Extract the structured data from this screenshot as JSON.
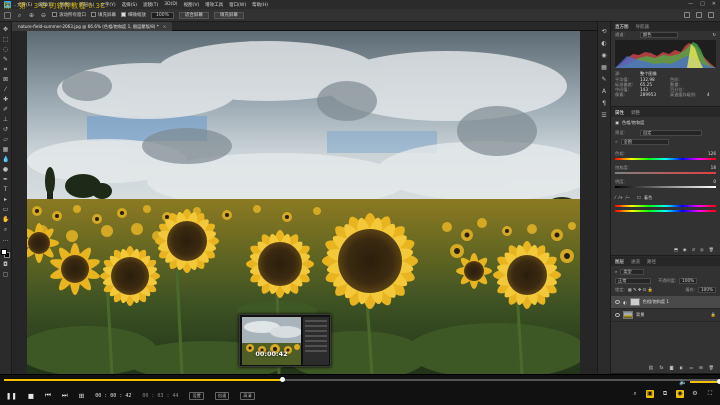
{
  "menubar": {
    "overlay_title": "陈 · 第 · 3 D 的软件教程 0.3C",
    "items": [
      "文件(F)",
      "编辑(E)",
      "图像(I)",
      "图层(L)",
      "文字(Y)",
      "选择(S)",
      "滤镜(T)",
      "3D(D)",
      "视图(V)",
      "增效工具",
      "窗口(W)",
      "帮助(H)"
    ],
    "window_buttons": [
      "—",
      "□",
      "✕"
    ]
  },
  "optionsbar": {
    "scroll_all_label": "滚动所有窗口",
    "fit_screen_label": "填充屏幕",
    "actual_pixels_label": "细微缩放",
    "zoom_value": "100%",
    "fit_button": "适合屏幕",
    "fill_button": "填充屏幕"
  },
  "document": {
    "tab_label": "nature-field-summer-2063.jpg @ 66.6% (色相/饱和度 1, 图层蒙版/8) *",
    "close_glyph": "×"
  },
  "thumbnail": {
    "time": "00:00:42"
  },
  "histogram_panel": {
    "tabs": [
      "直方图",
      "导航器"
    ],
    "channel_label": "通道:",
    "channel_value": "颜色",
    "source_label": "源:",
    "source_value": "整个图像",
    "stats": [
      {
        "k": "平均值:",
        "v": "132.98"
      },
      {
        "k": "标准偏差:",
        "v": "65.25"
      },
      {
        "k": "中间值:",
        "v": "143"
      },
      {
        "k": "像素:",
        "v": "289953"
      }
    ],
    "stats_right": [
      {
        "k": "色阶:",
        "v": ""
      },
      {
        "k": "数量:",
        "v": ""
      },
      {
        "k": "百分位:",
        "v": ""
      },
      {
        "k": "高速缓存级别:",
        "v": "4"
      }
    ]
  },
  "properties_panel": {
    "tabs": [
      "属性",
      "调整"
    ],
    "title": "色相/饱和度",
    "preset_label": "预设:",
    "preset_value": "自定",
    "channel_value": "全图",
    "hue_label": "色相:",
    "hue_value": "126",
    "sat_label": "饱和度:",
    "sat_value": "18",
    "light_label": "明度:",
    "light_value": "0",
    "colorize_label": "着色"
  },
  "layers_panel": {
    "tabs": [
      "图层",
      "通道",
      "路径"
    ],
    "kind_label": "类型",
    "blend_mode": "正常",
    "opacity_label": "不透明度:",
    "opacity_value": "100%",
    "lock_label": "锁定:",
    "fill_label": "填充:",
    "fill_value": "100%",
    "layers": [
      {
        "name": "色相/饱和度 1",
        "selected": true
      },
      {
        "name": "背景",
        "selected": false
      }
    ]
  },
  "player": {
    "current_time": "00 : 00 : 42",
    "total_time": "00 : 03 : 44",
    "badges": [
      "设置",
      "倍速",
      "高清"
    ],
    "progress": 0.39,
    "volume": 1.0
  },
  "colors": {
    "accent": "#f2c200",
    "ps_blue": "#31a8ff",
    "panel_bg": "#323232",
    "app_bg": "#1e1e1e"
  }
}
